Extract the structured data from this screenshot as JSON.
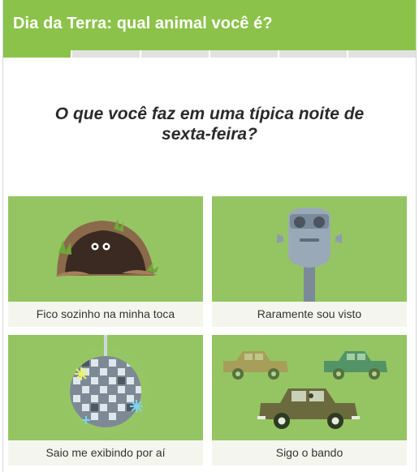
{
  "quiz": {
    "title": "Dia da Terra: qual animal você é?",
    "progress": {
      "current_step": 1,
      "total_steps": 6
    },
    "question": "O que você faz em uma típica noite de sexta-feira?"
  },
  "options": [
    {
      "label": "Fico sozinho na minha toca",
      "icon": "burrow-icon"
    },
    {
      "label": "Raramente sou visto",
      "icon": "binoculars-icon"
    },
    {
      "label": "Saio me exibindo por aí",
      "icon": "disco-ball-icon"
    },
    {
      "label": "Sigo o bando",
      "icon": "cars-icon"
    }
  ],
  "colors": {
    "accent": "#8bc34a",
    "tile": "#95c563",
    "tile_label_bg": "#f4f6ee",
    "progress_empty": "#e2e2e2"
  }
}
